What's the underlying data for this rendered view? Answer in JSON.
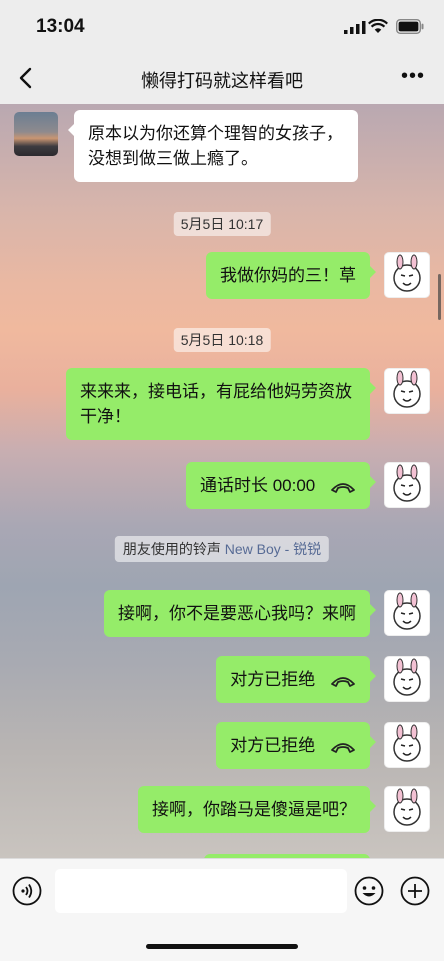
{
  "status": {
    "time": "13:04"
  },
  "nav": {
    "title": "懒得打码就这样看吧",
    "more_label": "•••"
  },
  "messages": [
    {
      "side": "left",
      "text": "原本以为你还算个理智的女孩子，没想到做三做上瘾了。"
    },
    {
      "type": "time",
      "text": "5月5日 10:17"
    },
    {
      "side": "right",
      "text": "我做你妈的三！草"
    },
    {
      "type": "time",
      "text": "5月5日 10:18"
    },
    {
      "side": "right",
      "text": "来来来，接电话，有屁给他妈劳资放干净！"
    },
    {
      "side": "right",
      "text": "通话时长 00:00",
      "call": true
    },
    {
      "type": "system",
      "text": "朋友使用的铃声",
      "song": "New Boy - 锐锐"
    },
    {
      "side": "right",
      "text": "接啊，你不是要恶心我吗？来啊"
    },
    {
      "side": "right",
      "text": "对方已拒绝",
      "call": true
    },
    {
      "side": "right",
      "text": "对方已拒绝",
      "call": true
    },
    {
      "side": "right",
      "text": "接啊，你踏马是傻逼是吧？"
    }
  ],
  "input": {
    "placeholder": ""
  },
  "icons": {
    "back": "chevron-left-icon",
    "more": "more-dots-icon",
    "voice": "voice-icon",
    "emoji": "emoji-icon",
    "plus": "plus-icon",
    "call": "phone-hangup-icon"
  },
  "colors": {
    "green_bubble": "#95ec69",
    "white_bubble": "#ffffff",
    "link": "#576b95"
  }
}
